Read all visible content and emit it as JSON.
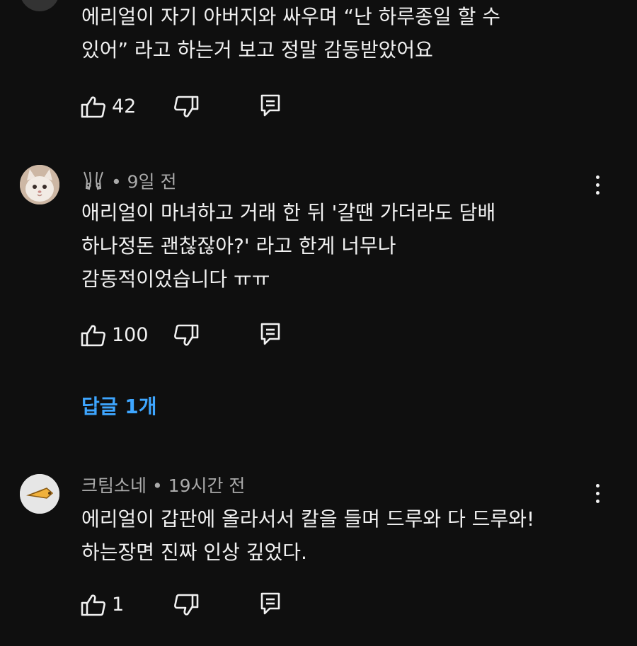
{
  "comments": [
    {
      "author": "",
      "time": "",
      "text": "에리얼이 자기 아버지와 싸우며 “난 하루종일 할 수\n있어” 라고 하는거 보고 정말 감동받았어요",
      "likes": "42"
    },
    {
      "author": "",
      "separator": "•",
      "time": "9일 전",
      "text": "애리얼이 마녀하고 거래 한 뒤 '갈땐 가더라도 담배\n하나정돈 괜찮잖아?' 라고 한게 너무나\n감동적이었습니다 ㅠㅠ",
      "likes": "100",
      "replies": "답글 1개"
    },
    {
      "author": "크팀소네",
      "separator": "•",
      "time": "19시간 전",
      "text": "에리얼이 갑판에 올라서서 칼을 들며 드루와 다 드루와!\n하는장면 진짜 인상 깊었다.",
      "likes": "1"
    }
  ],
  "icons": {
    "like": "thumbs-up-icon",
    "dislike": "thumbs-down-icon",
    "reply": "comment-icon",
    "more": "kebab-menu-icon",
    "author_badge": "hands-icon"
  },
  "colors": {
    "background": "#0f0f0f",
    "text": "#f1f1f1",
    "meta": "#aaaaaa",
    "link": "#3ea6ff"
  }
}
